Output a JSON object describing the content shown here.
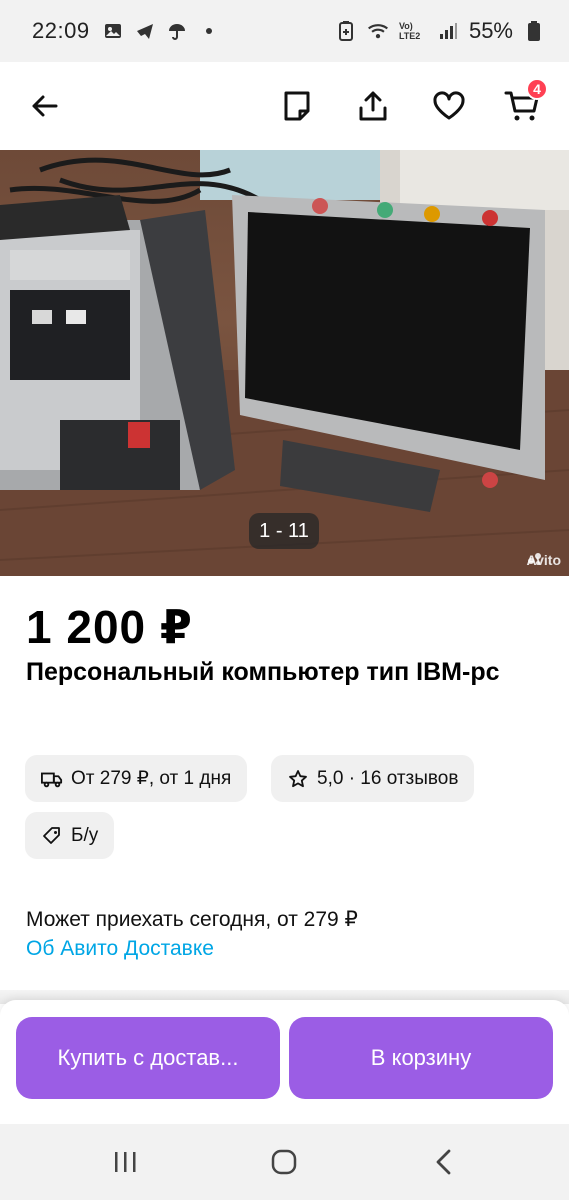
{
  "status_bar": {
    "time": "22:09",
    "battery": "55%",
    "network_label": "Vo) LTE2",
    "left_icons": [
      "image-icon",
      "telegram-icon",
      "umbrella-icon",
      "dot-icon"
    ],
    "right_icons": [
      "battery-saver-icon",
      "wifi-icon",
      "volte-icon",
      "signal-icon",
      "battery-icon"
    ]
  },
  "toolbar": {
    "cart_count": "4",
    "icons": [
      "back-arrow-icon",
      "note-icon",
      "share-icon",
      "heart-icon",
      "cart-icon"
    ]
  },
  "gallery": {
    "counter": "1 - 11",
    "watermark": "Avito"
  },
  "listing": {
    "price": "1 200 ₽",
    "title": "Персональный компьютер тип IBM-pc"
  },
  "chips": {
    "delivery": "От 279 ₽, от 1 дня",
    "rating": "5,0 · 16 отзывов",
    "condition": "Б/у"
  },
  "delivery": {
    "text": "Может приехать сегодня, от 279 ₽",
    "link": "Об Авито Доставке"
  },
  "actions": {
    "buy_label": "Купить с достав...",
    "cart_label": "В корзину"
  },
  "colors": {
    "accent": "#9b5de5",
    "link": "#00a6e5",
    "badge": "#ff4053"
  }
}
